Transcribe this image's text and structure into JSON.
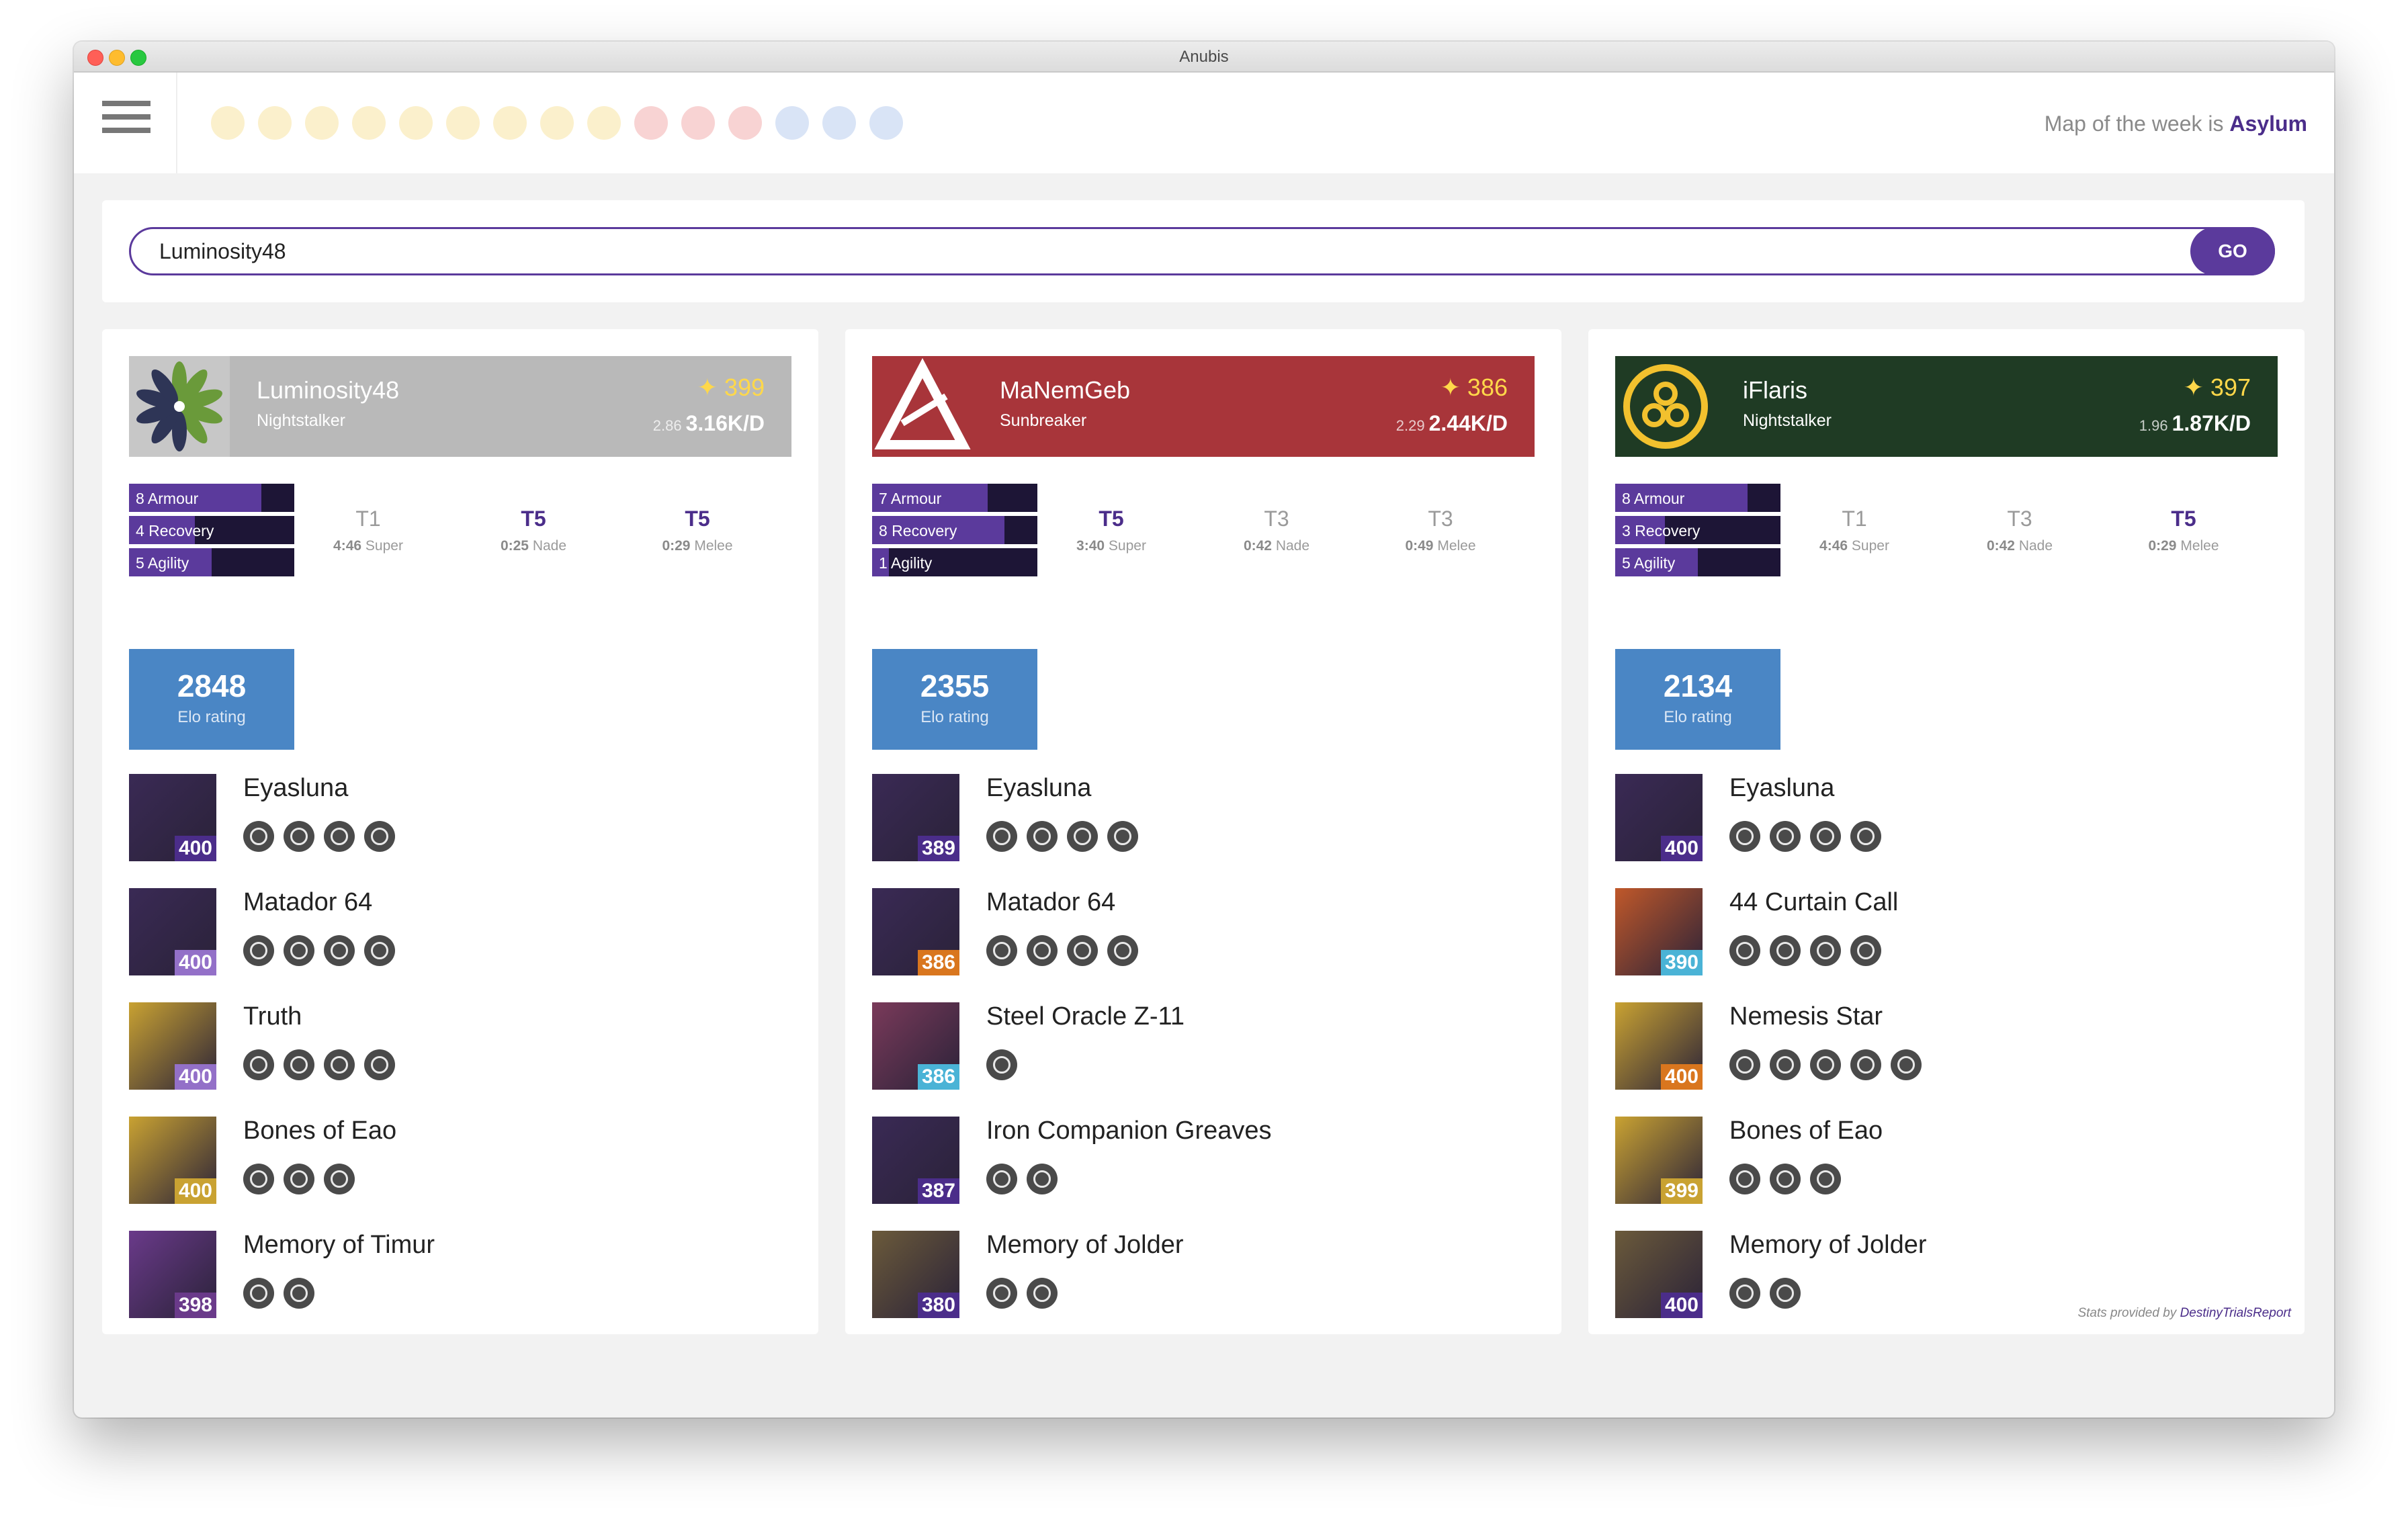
{
  "window": {
    "title": "Anubis"
  },
  "header": {
    "map_prefix": "Map of the week is",
    "map_name": "Asylum",
    "dots": [
      {
        "color": "#fbf0cc"
      },
      {
        "color": "#fbf0cc"
      },
      {
        "color": "#fbf0cc"
      },
      {
        "color": "#fbf0cc"
      },
      {
        "color": "#fbf0cc"
      },
      {
        "color": "#fbf0cc"
      },
      {
        "color": "#fbf0cc"
      },
      {
        "color": "#fbf0cc"
      },
      {
        "color": "#fbf0cc"
      },
      {
        "color": "#f8d3d3"
      },
      {
        "color": "#f8d3d3"
      },
      {
        "color": "#f8d3d3"
      },
      {
        "color": "#d9e4f6"
      },
      {
        "color": "#d9e4f6"
      },
      {
        "color": "#d9e4f6"
      }
    ]
  },
  "search": {
    "value": "Luminosity48",
    "button": "GO"
  },
  "credit": {
    "prefix": "Stats provided by",
    "source": "DestinyTrialsReport"
  },
  "players": [
    {
      "name": "Luminosity48",
      "subclass": "Nightstalker",
      "light": "✦ 399",
      "kd_prev": "2.86",
      "kd": "3.16K/D",
      "banner_color": "#b9b9b9",
      "emblem": "flower-emblem",
      "stats": [
        {
          "label": "8 Armour",
          "value": 8
        },
        {
          "label": "4 Recovery",
          "value": 4
        },
        {
          "label": "5 Agility",
          "value": 5
        }
      ],
      "tiers": [
        {
          "tier": "T1",
          "time": "4:46",
          "kind": "Super",
          "highlight": false
        },
        {
          "tier": "T5",
          "time": "0:25",
          "kind": "Nade",
          "highlight": true
        },
        {
          "tier": "T5",
          "time": "0:29",
          "kind": "Melee",
          "highlight": true
        }
      ],
      "elo": "2848",
      "elo_label": "Elo rating",
      "items": [
        {
          "name": "Eyasluna",
          "power": "400",
          "power_color": "#4b2d8a",
          "thumb_color": "#3a2a55",
          "perks": 4
        },
        {
          "name": "Matador 64",
          "power": "400",
          "power_color": "#9370c8",
          "thumb_color": "#3a2a55",
          "perks": 4
        },
        {
          "name": "Truth",
          "power": "400",
          "power_color": "#9370c8",
          "thumb_color": "#c9a232",
          "perks": 4
        },
        {
          "name": "Bones of Eao",
          "power": "400",
          "power_color": "#c9a232",
          "thumb_color": "#c9a232",
          "perks": 3
        },
        {
          "name": "Memory of Timur",
          "power": "398",
          "power_color": "#6a3a8a",
          "thumb_color": "#6a3a8a",
          "perks": 2
        }
      ]
    },
    {
      "name": "MaNemGeb",
      "subclass": "Sunbreaker",
      "light": "✦ 386",
      "kd_prev": "2.29",
      "kd": "2.44K/D",
      "banner_color": "#a8353a",
      "emblem": "triangle-emblem",
      "stats": [
        {
          "label": "7 Armour",
          "value": 7
        },
        {
          "label": "8 Recovery",
          "value": 8
        },
        {
          "label": "1 Agility",
          "value": 1
        }
      ],
      "tiers": [
        {
          "tier": "T5",
          "time": "3:40",
          "kind": "Super",
          "highlight": true
        },
        {
          "tier": "T3",
          "time": "0:42",
          "kind": "Nade",
          "highlight": false
        },
        {
          "tier": "T3",
          "time": "0:49",
          "kind": "Melee",
          "highlight": false
        }
      ],
      "elo": "2355",
      "elo_label": "Elo rating",
      "items": [
        {
          "name": "Eyasluna",
          "power": "389",
          "power_color": "#4b2d8a",
          "thumb_color": "#3a2a55",
          "perks": 4
        },
        {
          "name": "Matador 64",
          "power": "386",
          "power_color": "#d9761e",
          "thumb_color": "#3a2a55",
          "perks": 4
        },
        {
          "name": "Steel Oracle Z-11",
          "power": "386",
          "power_color": "#4ab3d6",
          "thumb_color": "#7a3a5a",
          "perks": 1
        },
        {
          "name": "Iron Companion Greaves",
          "power": "387",
          "power_color": "#4b2d8a",
          "thumb_color": "#3a2a55",
          "perks": 2
        },
        {
          "name": "Memory of Jolder",
          "power": "380",
          "power_color": "#4b2d8a",
          "thumb_color": "#6b5a3a",
          "perks": 2
        }
      ]
    },
    {
      "name": "iFlaris",
      "subclass": "Nightstalker",
      "light": "✦ 397",
      "kd_prev": "1.96",
      "kd": "1.87K/D",
      "banner_color": "#1f3b24",
      "emblem": "rings-emblem",
      "stats": [
        {
          "label": "8 Armour",
          "value": 8
        },
        {
          "label": "3 Recovery",
          "value": 3
        },
        {
          "label": "5 Agility",
          "value": 5
        }
      ],
      "tiers": [
        {
          "tier": "T1",
          "time": "4:46",
          "kind": "Super",
          "highlight": false
        },
        {
          "tier": "T3",
          "time": "0:42",
          "kind": "Nade",
          "highlight": false
        },
        {
          "tier": "T5",
          "time": "0:29",
          "kind": "Melee",
          "highlight": true
        }
      ],
      "elo": "2134",
      "elo_label": "Elo rating",
      "items": [
        {
          "name": "Eyasluna",
          "power": "400",
          "power_color": "#4b2d8a",
          "thumb_color": "#3a2a55",
          "perks": 4
        },
        {
          "name": "44 Curtain Call",
          "power": "390",
          "power_color": "#4ab3d6",
          "thumb_color": "#c0582a",
          "perks": 4
        },
        {
          "name": "Nemesis Star",
          "power": "400",
          "power_color": "#d9761e",
          "thumb_color": "#c9a232",
          "perks": 5
        },
        {
          "name": "Bones of Eao",
          "power": "399",
          "power_color": "#c9a232",
          "thumb_color": "#c9a232",
          "perks": 3
        },
        {
          "name": "Memory of Jolder",
          "power": "400",
          "power_color": "#4b2d8a",
          "thumb_color": "#6b5a3a",
          "perks": 2
        }
      ]
    }
  ]
}
